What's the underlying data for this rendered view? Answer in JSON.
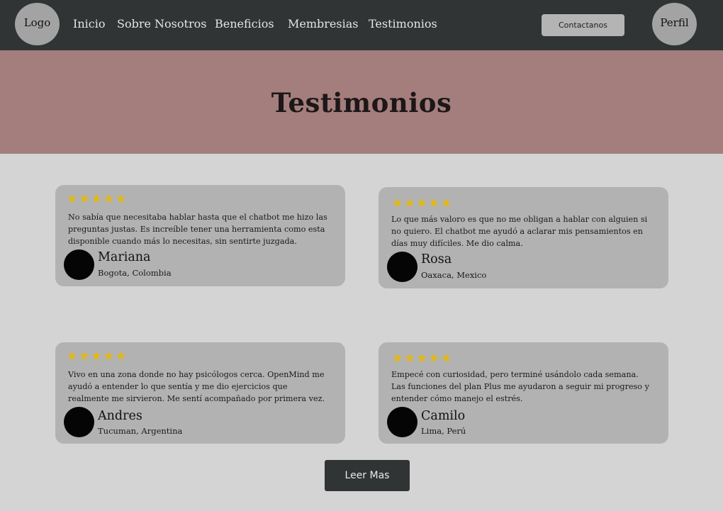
{
  "navbar": {
    "logo": "Logo",
    "items": [
      "Inicio",
      "Sobre Nosotros",
      "Beneficios",
      "Membresias",
      "Testimonios"
    ],
    "contact_label": "Contactanos",
    "profile_label": "Perfil"
  },
  "hero": {
    "title": "Testimonios"
  },
  "testimonials": [
    {
      "rating": 5,
      "stars": "★★★★★",
      "quote": "No sabía que necesitaba hablar hasta que el chatbot me hizo las preguntas justas. Es increíble tener una herramienta como esta disponible cuando más lo necesitas, sin sentirte juzgada.",
      "name": "Mariana",
      "location": "Bogota, Colombia"
    },
    {
      "rating": 5,
      "stars": "★★★★★",
      "quote": "Lo que más valoro es que no me obligan a hablar con alguien si no quiero. El chatbot me ayudó a aclarar mis pensamientos en días muy difíciles. Me dio calma.",
      "name": "Rosa",
      "location": "Oaxaca, Mexico"
    },
    {
      "rating": 5,
      "stars": "★★★★★",
      "quote": "Vivo en una zona donde no hay psicólogos cerca. OpenMind me ayudó a entender lo que sentía y me dio ejercicios que realmente me sirvieron. Me sentí acompañado por primera vez.",
      "name": "Andres",
      "location": "Tucuman, Argentina"
    },
    {
      "rating": 5,
      "stars": "★★★★★",
      "quote": "Empecé con curiosidad, pero terminé usándolo cada semana. Las funciones del plan Plus me ayudaron a seguir mi progreso y entender cómo manejo el estrés.",
      "name": "Camilo",
      "location": "Lima, Perú"
    }
  ],
  "read_more_label": "Leer Mas",
  "colors": {
    "navbar": "#303434",
    "hero": "#a47d7d",
    "background": "#d4d4d4",
    "card": "#b2b2b2",
    "star": "#e5b80b"
  }
}
